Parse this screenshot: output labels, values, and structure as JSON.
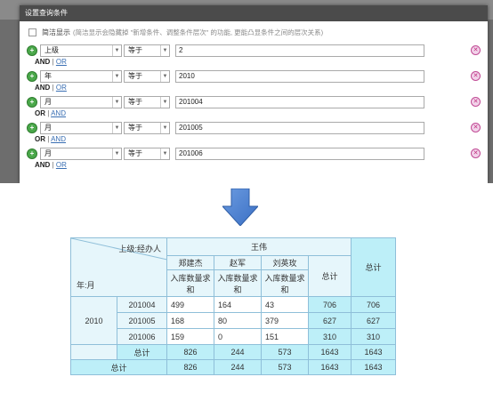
{
  "dialog": {
    "title": "设置查询条件",
    "simple_display_label": "简洁显示",
    "simple_display_hint": "(简洁显示会隐藏掉 \"新增条件、调整条件层次\" 的功能, 更能凸显条件之间的层次关系)",
    "add_icon": "plus-circle-icon",
    "delete_icon": "close-circle-icon",
    "and_label": "AND",
    "or_label": "OR",
    "separator": "|",
    "conditions": [
      {
        "field": "上级",
        "operator": "等于",
        "value": "2",
        "logic_active": "AND",
        "logic_other": "OR"
      },
      {
        "field": "年",
        "operator": "等于",
        "value": "2010",
        "logic_active": "AND",
        "logic_other": "OR"
      },
      {
        "field": "月",
        "operator": "等于",
        "value": "201004",
        "logic_active": "OR",
        "logic_other": "AND"
      },
      {
        "field": "月",
        "operator": "等于",
        "value": "201005",
        "logic_active": "OR",
        "logic_other": "AND"
      },
      {
        "field": "月",
        "operator": "等于",
        "value": "201006",
        "logic_active": "AND",
        "logic_other": "OR"
      }
    ]
  },
  "arrow_icon": "arrow-down-icon",
  "pivot": {
    "corner_top": "上级:经办人",
    "corner_bottom": "年:月",
    "group_header": "王伟",
    "people": [
      "郑建杰",
      "赵军",
      "刘英玫"
    ],
    "measure": "入库数量求和",
    "subtotal_label": "总计",
    "grand_total_label": "总计",
    "year": "2010",
    "rows": [
      {
        "month": "201004",
        "values": [
          "499",
          "164",
          "43"
        ],
        "subtotal": "706",
        "total": "706"
      },
      {
        "month": "201005",
        "values": [
          "168",
          "80",
          "379"
        ],
        "subtotal": "627",
        "total": "627"
      },
      {
        "month": "201006",
        "values": [
          "159",
          "0",
          "151"
        ],
        "subtotal": "310",
        "total": "310"
      }
    ],
    "year_total": {
      "label": "总计",
      "values": [
        "826",
        "244",
        "573"
      ],
      "subtotal": "1643",
      "total": "1643"
    },
    "grand_total": {
      "label": "总计",
      "values": [
        "826",
        "244",
        "573"
      ],
      "subtotal": "1643",
      "total": "1643"
    }
  }
}
